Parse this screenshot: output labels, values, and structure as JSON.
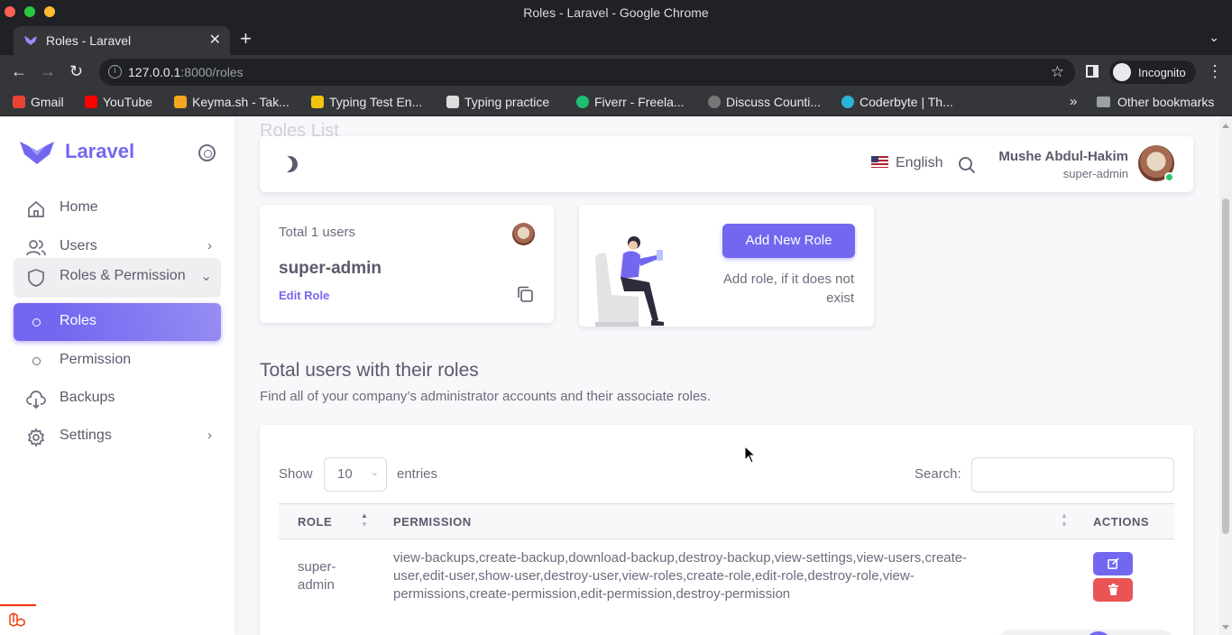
{
  "browser": {
    "window_title": "Roles - Laravel - Google Chrome",
    "tab_title": "Roles - Laravel",
    "url_host": "127.0.0.1",
    "url_path": ":8000/roles",
    "profile_label": "Incognito",
    "bookmarks": [
      {
        "label": "Gmail",
        "color": "#ea4335"
      },
      {
        "label": "YouTube",
        "color": "#ff0000"
      },
      {
        "label": "Keyma.sh - Tak...",
        "color": "#f5a623"
      },
      {
        "label": "Typing Test En...",
        "color": "#f1c40f"
      },
      {
        "label": "Typing practice",
        "color": "#dddddd"
      },
      {
        "label": "Fiverr - Freela...",
        "color": "#1dbf73"
      },
      {
        "label": "Discuss Counti...",
        "color": "#777777"
      },
      {
        "label": "Coderbyte | Th...",
        "color": "#2bb3d6"
      }
    ],
    "other_bookmarks": "Other bookmarks"
  },
  "sidebar": {
    "brand": "Laravel",
    "items": [
      {
        "label": "Home",
        "icon": "home-icon"
      },
      {
        "label": "Users",
        "icon": "users-icon"
      },
      {
        "label": "Roles & Permission",
        "icon": "shield-icon"
      },
      {
        "label": "Roles",
        "icon": "circle-icon"
      },
      {
        "label": "Permission",
        "icon": "circle-icon"
      },
      {
        "label": "Backups",
        "icon": "cloud-download-icon"
      },
      {
        "label": "Settings",
        "icon": "gear-icon"
      }
    ]
  },
  "page": {
    "heading": "Roles List"
  },
  "topnav": {
    "language": "English",
    "user_name": "Mushe Abdul-Hakim",
    "user_role": "super-admin"
  },
  "role_card": {
    "total": "Total 1 users",
    "role_name": "super-admin",
    "edit_label": "Edit Role"
  },
  "add_card": {
    "button": "Add New Role",
    "hint": "Add role, if it does not exist"
  },
  "section": {
    "title": "Total users with their roles",
    "subtitle": "Find all of your company’s administrator accounts and their associate roles."
  },
  "table": {
    "show_label": "Show",
    "page_length": "10",
    "entries_label": "entries",
    "search_label": "Search:",
    "columns": [
      "ROLE",
      "PERMISSION",
      "ACTIONS"
    ],
    "rows": [
      {
        "role_line1": "super-",
        "role_line2": "admin",
        "perm_line1": "view-backups,create-backup,download-backup,destroy-backup,view-settings,view-users,create-",
        "perm_line2": "user,edit-user,show-user,destroy-user,view-roles,create-role,edit-role,destroy-role,view-",
        "perm_line3": "permissions,create-permission,edit-permission,destroy-permission"
      }
    ]
  },
  "colors": {
    "primary": "#7367f0",
    "danger": "#ea5455",
    "online": "#28c76f"
  }
}
